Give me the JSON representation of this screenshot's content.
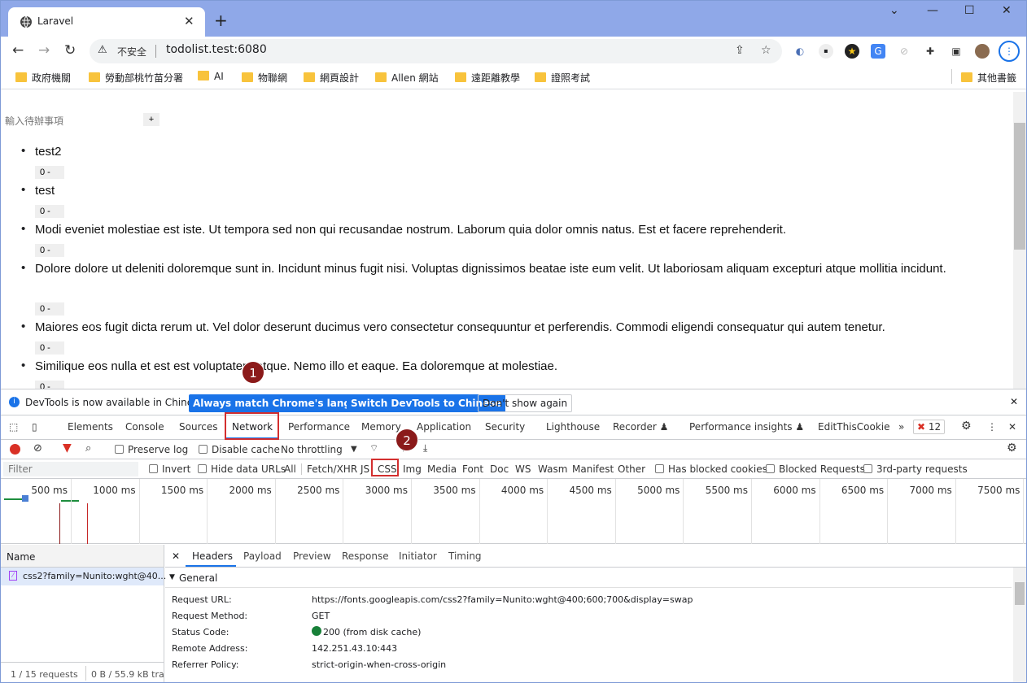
{
  "browser": {
    "tab_title": "Laravel",
    "tab_close": "✕",
    "new_tab": "+",
    "win_min": "—",
    "win_max": "☐",
    "win_close": "✕",
    "win_menu": "⌄",
    "security_label": "不安全",
    "url": "todolist.test:6080",
    "bookmarks": [
      "政府機關",
      "勞動部桃竹苗分署",
      "AI",
      "物聯網",
      "網頁設計",
      "Allen 網站",
      "遠距離教學",
      "證照考試"
    ],
    "other_bookmarks": "其他書籤"
  },
  "page": {
    "input_placeholder": "輸入待辦事項",
    "add_label": "+",
    "count_label": "0   -",
    "todos": [
      {
        "text": "test2"
      },
      {
        "text": "test"
      },
      {
        "text": "Modi eveniet molestiae est iste. Ut tempora sed non qui recusandae nostrum. Laborum quia dolor omnis natus. Est et facere reprehenderit."
      },
      {
        "text": "Dolore dolore ut deleniti doloremque sunt in. Incidunt minus fugit nisi. Voluptas dignissimos beatae iste eum velit. Ut laboriosam aliquam excepturi atque mollitia incidunt."
      },
      {
        "text": "Maiores eos fugit dicta rerum ut. Vel dolor deserunt ducimus vero consectetur consequuntur et perferendis. Commodi eligendi consequatur qui autem tenetur."
      },
      {
        "text": "Similique eos nulla et est est voluptatem atque. Nemo illo et eaque. Ea doloremque at molestiae."
      }
    ]
  },
  "devtools": {
    "info_message": "DevTools is now available in Chinese!",
    "btn_match": "Always match Chrome's language",
    "btn_switch": "Switch DevTools to Chinese",
    "btn_dont_show": "Don't show again",
    "tabs": [
      "Elements",
      "Console",
      "Sources",
      "Network",
      "Performance",
      "Memory",
      "Application",
      "Security",
      "Lighthouse",
      "Recorder ♟",
      "Performance insights ♟",
      "EditThisCookie"
    ],
    "more_tabs": "»",
    "issues_count": "12",
    "preserve_log": "Preserve log",
    "disable_cache": "Disable cache",
    "throttling": "No throttling",
    "filter_placeholder": "Filter",
    "invert": "Invert",
    "hide_data_urls": "Hide data URLs",
    "types": [
      "All",
      "Fetch/XHR",
      "JS",
      "CSS",
      "Img",
      "Media",
      "Font",
      "Doc",
      "WS",
      "Wasm",
      "Manifest",
      "Other"
    ],
    "has_blocked_cookies": "Has blocked cookies",
    "blocked_requests": "Blocked Requests",
    "third_party": "3rd-party requests",
    "timeline_ticks": [
      "500 ms",
      "1000 ms",
      "1500 ms",
      "2000 ms",
      "2500 ms",
      "3000 ms",
      "3500 ms",
      "4000 ms",
      "4500 ms",
      "5000 ms",
      "5500 ms",
      "6000 ms",
      "6500 ms",
      "7000 ms",
      "7500 ms"
    ],
    "name_header": "Name",
    "request_name": "css2?family=Nunito:wght@40...",
    "footer_requests": "1 / 15 requests",
    "footer_size": "0 B / 55.9 kB trar",
    "detail_close": "✕",
    "detail_tabs": [
      "Headers",
      "Payload",
      "Preview",
      "Response",
      "Initiator",
      "Timing"
    ],
    "general_label": "General",
    "headers": [
      {
        "key": "Request URL:",
        "value": "https://fonts.googleapis.com/css2?family=Nunito:wght@400;600;700&display=swap"
      },
      {
        "key": "Request Method:",
        "value": "GET"
      },
      {
        "key": "Status Code:",
        "value": "200 (from disk cache)"
      },
      {
        "key": "Remote Address:",
        "value": "142.251.43.10:443"
      },
      {
        "key": "Referrer Policy:",
        "value": "strict-origin-when-cross-origin"
      }
    ]
  },
  "annotations": {
    "marker1": "1",
    "marker2": "2"
  },
  "colors": {
    "accent": "#1a73e8",
    "annotation_red": "#d32f2f",
    "marker": "#8b1a1a",
    "status_ok": "#188038"
  }
}
